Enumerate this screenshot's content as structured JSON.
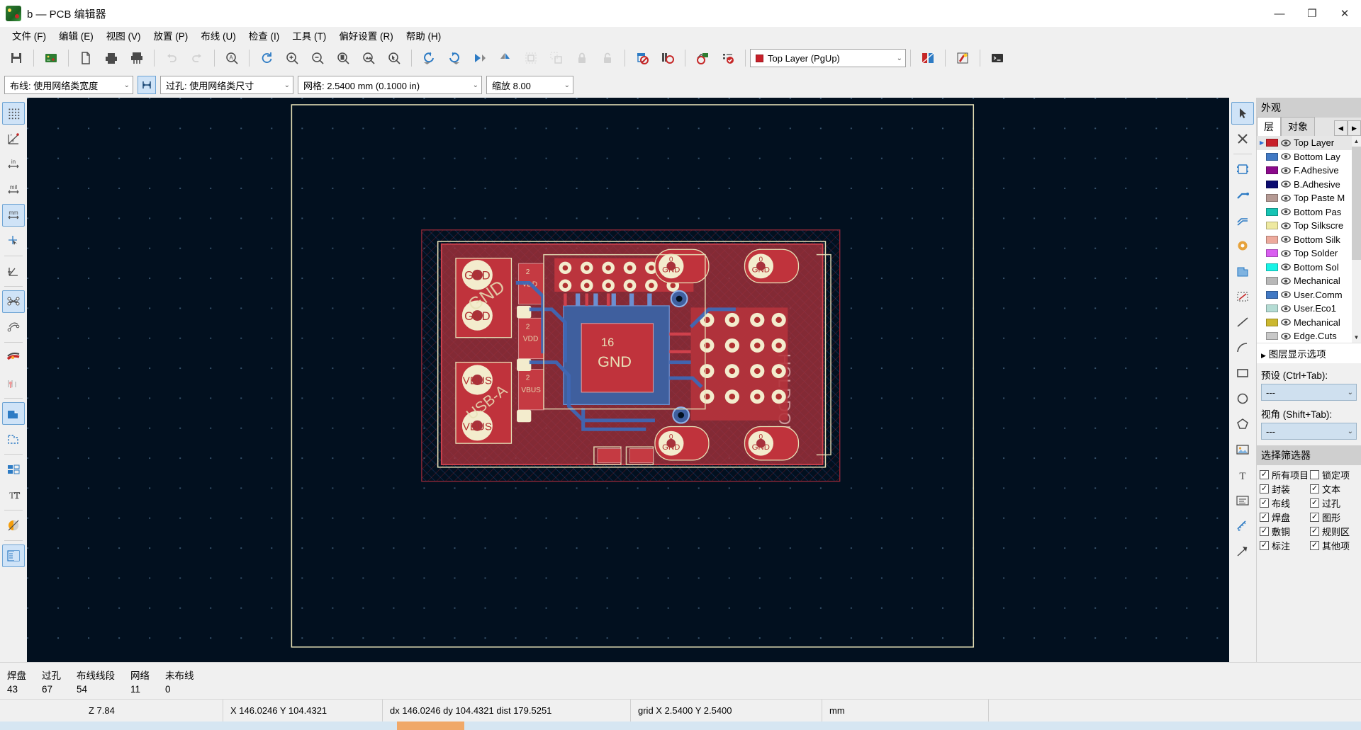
{
  "window": {
    "title": "b — PCB 编辑器",
    "minimize": "—",
    "maximize": "❐",
    "close": "✕"
  },
  "menubar": [
    {
      "label": "文件 (F)",
      "name": "menu-file"
    },
    {
      "label": "编辑 (E)",
      "name": "menu-edit"
    },
    {
      "label": "视图 (V)",
      "name": "menu-view"
    },
    {
      "label": "放置 (P)",
      "name": "menu-place"
    },
    {
      "label": "布线 (U)",
      "name": "menu-route"
    },
    {
      "label": "检查 (I)",
      "name": "menu-inspect"
    },
    {
      "label": "工具 (T)",
      "name": "menu-tools"
    },
    {
      "label": "偏好设置 (R)",
      "name": "menu-preferences"
    },
    {
      "label": "帮助 (H)",
      "name": "menu-help"
    }
  ],
  "toolbar": {
    "items": [
      {
        "name": "save-icon",
        "glyph": "save"
      },
      {
        "name": "separator",
        "glyph": "sep"
      },
      {
        "name": "board-setup-icon",
        "glyph": "board"
      },
      {
        "name": "separator",
        "glyph": "sep"
      },
      {
        "name": "page-settings-icon",
        "glyph": "page"
      },
      {
        "name": "print-icon",
        "glyph": "print"
      },
      {
        "name": "plot-icon",
        "glyph": "plot"
      },
      {
        "name": "separator",
        "glyph": "sep"
      },
      {
        "name": "undo-icon",
        "glyph": "undo",
        "disabled": true
      },
      {
        "name": "redo-icon",
        "glyph": "redo",
        "disabled": true
      },
      {
        "name": "separator",
        "glyph": "sep"
      },
      {
        "name": "find-icon",
        "glyph": "find"
      },
      {
        "name": "separator",
        "glyph": "sep"
      },
      {
        "name": "refresh-icon",
        "glyph": "refresh"
      },
      {
        "name": "zoom-in-icon",
        "glyph": "zoomin"
      },
      {
        "name": "zoom-out-icon",
        "glyph": "zoomout"
      },
      {
        "name": "zoom-fit-page-icon",
        "glyph": "zoompage"
      },
      {
        "name": "zoom-fit-objects-icon",
        "glyph": "zoomobj"
      },
      {
        "name": "zoom-area-icon",
        "glyph": "zoomarea"
      },
      {
        "name": "separator",
        "glyph": "sep"
      },
      {
        "name": "rotate-ccw-icon",
        "glyph": "rotccw"
      },
      {
        "name": "rotate-cw-icon",
        "glyph": "rotcw"
      },
      {
        "name": "flip-horizontal-icon",
        "glyph": "mirrorh"
      },
      {
        "name": "flip-vertical-icon",
        "glyph": "mirrorv"
      },
      {
        "name": "group-icon",
        "glyph": "group",
        "disabled": true
      },
      {
        "name": "ungroup-icon",
        "glyph": "ungroup",
        "disabled": true
      },
      {
        "name": "lock-icon",
        "glyph": "lock",
        "disabled": true
      },
      {
        "name": "unlock-icon",
        "glyph": "unlock",
        "disabled": true
      },
      {
        "name": "separator",
        "glyph": "sep"
      },
      {
        "name": "footprint-editor-icon",
        "glyph": "fpedit"
      },
      {
        "name": "footprint-library-icon",
        "glyph": "fplib"
      },
      {
        "name": "separator",
        "glyph": "sep"
      },
      {
        "name": "update-pcb-icon",
        "glyph": "netlist"
      },
      {
        "name": "drc-icon",
        "glyph": "drc"
      },
      {
        "name": "separator",
        "glyph": "sep"
      }
    ],
    "layer_select": {
      "value": "Top Layer (PgUp)",
      "swatch": "#c8202a",
      "arrow": "⌄"
    },
    "trailing": [
      {
        "name": "layer-pair-icon",
        "glyph": "layerpair"
      },
      {
        "name": "highlight-net-icon",
        "glyph": "highlight"
      },
      {
        "name": "scripting-console-icon",
        "glyph": "console"
      }
    ]
  },
  "toolbar2": {
    "track_width": {
      "label": "布线: 使用网络类宽度",
      "arrow": "⌄"
    },
    "track_width_lock_name": "track-width-lock-button",
    "via_size": {
      "label": "过孔: 使用网络类尺寸",
      "arrow": "⌄"
    },
    "grid": {
      "label": "网格: 2.5400 mm (0.1000 in)",
      "arrow": "⌄"
    },
    "zoom": {
      "label": "缩放 8.00",
      "arrow": "⌄"
    }
  },
  "left_toolbar": [
    {
      "name": "grid-toggle-icon",
      "glyph": "griddots",
      "active": true
    },
    {
      "name": "polar-coordinates-icon",
      "glyph": "polar",
      "active": false
    },
    {
      "name": "units-inches-icon",
      "glyph": "in",
      "active": false
    },
    {
      "name": "units-mils-icon",
      "glyph": "mil",
      "active": false
    },
    {
      "name": "units-mm-icon",
      "glyph": "mm",
      "active": true
    },
    {
      "name": "full-crosshair-icon",
      "glyph": "crosshair",
      "active": false
    },
    {
      "sep": true
    },
    {
      "name": "45-degree-mode-icon",
      "glyph": "deg45",
      "active": false
    },
    {
      "sep": true
    },
    {
      "name": "show-ratsnest-icon",
      "glyph": "ratsnest",
      "active": true
    },
    {
      "name": "curved-ratsnest-icon",
      "glyph": "curvedrats",
      "active": false
    },
    {
      "sep": true
    },
    {
      "name": "track-fill-mode-icon",
      "glyph": "trackfill",
      "active": false
    },
    {
      "name": "via-fill-mode-icon",
      "glyph": "viafill",
      "active": false
    },
    {
      "sep": true
    },
    {
      "name": "zone-fill-mode-icon",
      "glyph": "zonefill",
      "active": true
    },
    {
      "name": "zone-outline-mode-icon",
      "glyph": "zoneoutline",
      "active": false
    },
    {
      "sep": true
    },
    {
      "name": "pad-sketch-mode-icon",
      "glyph": "padsketch",
      "active": false
    },
    {
      "name": "text-sketch-mode-icon",
      "glyph": "textsketch",
      "active": false
    },
    {
      "sep": true
    },
    {
      "name": "contrast-mode-icon",
      "glyph": "contrast",
      "active": false
    },
    {
      "sep": true
    },
    {
      "name": "layers-manager-icon",
      "glyph": "layersmgr",
      "active": true
    }
  ],
  "right_toolbar": [
    {
      "name": "select-tool-icon",
      "glyph": "cursor",
      "active": true
    },
    {
      "name": "delete-tool-icon",
      "glyph": "xdelete",
      "active": false
    },
    {
      "sep": true
    },
    {
      "name": "place-footprint-icon",
      "glyph": "fp",
      "active": false
    },
    {
      "name": "route-track-icon",
      "glyph": "track",
      "active": false
    },
    {
      "name": "route-diffpair-icon",
      "glyph": "diffpair",
      "active": false
    },
    {
      "name": "place-via-icon",
      "glyph": "via",
      "active": false
    },
    {
      "name": "draw-zone-icon",
      "glyph": "zone",
      "active": false
    },
    {
      "name": "draw-rule-area-icon",
      "glyph": "rulearea",
      "active": false
    },
    {
      "name": "draw-line-icon",
      "glyph": "line",
      "active": false
    },
    {
      "name": "draw-arc-icon",
      "glyph": "arc",
      "active": false
    },
    {
      "name": "draw-rectangle-icon",
      "glyph": "rect",
      "active": false
    },
    {
      "name": "draw-circle-icon",
      "glyph": "circle",
      "active": false
    },
    {
      "name": "draw-polygon-icon",
      "glyph": "polygon",
      "active": false
    },
    {
      "name": "place-image-icon",
      "glyph": "image",
      "active": false
    },
    {
      "name": "place-text-icon",
      "glyph": "texttool",
      "active": false
    },
    {
      "name": "place-textbox-icon",
      "glyph": "textbox",
      "active": false
    },
    {
      "name": "measure-tool-icon",
      "glyph": "measure",
      "active": false
    },
    {
      "name": "origin-tool-icon",
      "glyph": "origin",
      "active": false
    }
  ],
  "appearance": {
    "title": "外观",
    "tabs": [
      {
        "label": "层",
        "active": true,
        "name": "tab-layers"
      },
      {
        "label": "对象",
        "active": false,
        "name": "tab-objects"
      }
    ],
    "tab_prev": "◀",
    "tab_next": "▶",
    "layers": [
      {
        "label": "Top Layer",
        "color": "#c8202a",
        "selected": true
      },
      {
        "label": "Bottom Lay",
        "color": "#4179c4",
        "selected": false
      },
      {
        "label": "F.Adhesive",
        "color": "#8b0a8b",
        "selected": false
      },
      {
        "label": "B.Adhesive",
        "color": "#0c0c70",
        "selected": false
      },
      {
        "label": "Top Paste M",
        "color": "#b59a94",
        "selected": false
      },
      {
        "label": "Bottom Pas",
        "color": "#16c4b4",
        "selected": false
      },
      {
        "label": "Top Silkscre",
        "color": "#eee9a0",
        "selected": false
      },
      {
        "label": "Bottom Silk",
        "color": "#edaa9c",
        "selected": false
      },
      {
        "label": "Top Solder",
        "color": "#d95ef0",
        "selected": false
      },
      {
        "label": "Bottom Sol",
        "color": "#18f3e6",
        "selected": false
      },
      {
        "label": "Mechanical",
        "color": "#b8b8b8",
        "selected": false
      },
      {
        "label": "User.Comm",
        "color": "#4179c4",
        "selected": false
      },
      {
        "label": "User.Eco1",
        "color": "#b4dcd4",
        "selected": false
      },
      {
        "label": "Mechanical",
        "color": "#ccb830",
        "selected": false
      },
      {
        "label": "Edge.Cuts",
        "color": "#c8c8c8",
        "selected": false
      }
    ],
    "layer_display_options": "图层显示选项",
    "layer_display_arrow": "▶",
    "preset_label": "预设 (Ctrl+Tab):",
    "preset_value": "---",
    "viewport_label": "视角 (Shift+Tab):",
    "viewport_value": "---"
  },
  "selection_filter": {
    "title": "选择筛选器",
    "options": [
      {
        "label": "所有项目",
        "checked": true,
        "name": "filter-all-items"
      },
      {
        "label": "锁定项",
        "checked": false,
        "name": "filter-locked-items"
      },
      {
        "label": "封装",
        "checked": true,
        "name": "filter-footprints"
      },
      {
        "label": "文本",
        "checked": true,
        "name": "filter-text"
      },
      {
        "label": "布线",
        "checked": true,
        "name": "filter-tracks"
      },
      {
        "label": "过孔",
        "checked": true,
        "name": "filter-vias"
      },
      {
        "label": "焊盘",
        "checked": true,
        "name": "filter-pads"
      },
      {
        "label": "图形",
        "checked": true,
        "name": "filter-graphics"
      },
      {
        "label": "敷铜",
        "checked": true,
        "name": "filter-zones"
      },
      {
        "label": "规则区",
        "checked": true,
        "name": "filter-rule-areas"
      },
      {
        "label": "标注",
        "checked": true,
        "name": "filter-dimensions"
      },
      {
        "label": "其他项",
        "checked": true,
        "name": "filter-other-items"
      }
    ]
  },
  "stats": [
    {
      "key": "焊盘",
      "value": "43"
    },
    {
      "key": "过孔",
      "value": "67"
    },
    {
      "key": "布线线段",
      "value": "54"
    },
    {
      "key": "网络",
      "value": "11"
    },
    {
      "key": "未布线",
      "value": "0"
    }
  ],
  "statusbar": {
    "z": "Z 7.84",
    "xy": "X 146.0246  Y 104.4321",
    "delta": "dx 146.0246  dy 104.4321  dist 179.5251",
    "grid": "grid X 2.5400  Y 2.5400",
    "units": "mm"
  },
  "canvas": {
    "board_text_right": "HOLDDOLDO",
    "labels": {
      "gnd": "GND",
      "vbus": "VBUS",
      "vdd": "VDD",
      "usb": "USB-A"
    },
    "pad_labels": [
      "GND",
      "GND",
      "GND",
      "GND",
      "VBUS",
      "VBUS",
      "VDD",
      "VDD",
      "GND",
      "GND"
    ]
  }
}
